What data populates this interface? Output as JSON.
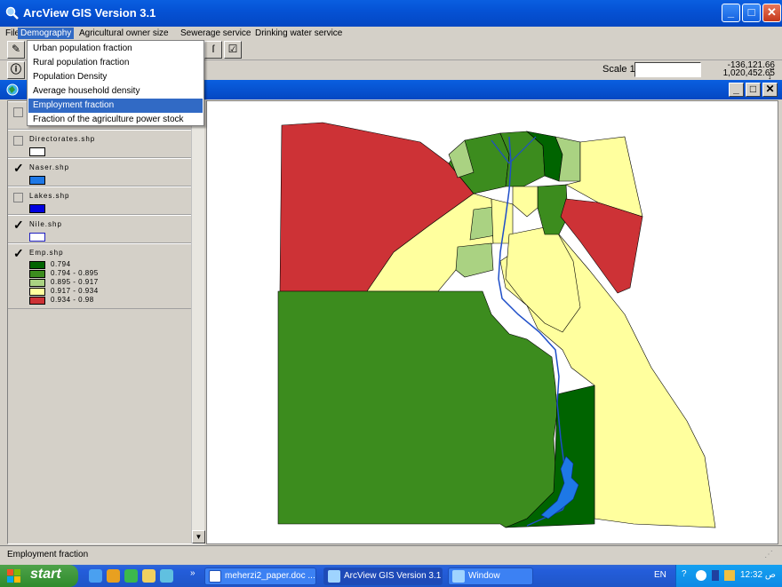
{
  "window": {
    "title": "ArcView GIS Version 3.1"
  },
  "menubar": {
    "items": [
      {
        "label": "File",
        "active": false
      },
      {
        "label": "Demography",
        "active": true
      },
      {
        "label": "Agricultural owner size",
        "active": false
      },
      {
        "label": "Sewerage service",
        "active": false
      },
      {
        "label": "Drinking water service",
        "active": false
      }
    ]
  },
  "dropdown": {
    "items": [
      {
        "label": "Urban population fraction",
        "selected": false
      },
      {
        "label": "Rural population fraction",
        "selected": false
      },
      {
        "label": "Population Density",
        "selected": false
      },
      {
        "label": "Average household density",
        "selected": false
      },
      {
        "label": "Employment fraction",
        "selected": true
      },
      {
        "label": "Fraction of the agriculture power stock",
        "selected": false
      }
    ]
  },
  "toolbar": {
    "scale_label": "Scale 1:",
    "scale_value": "",
    "coord_x": "-136,121.66",
    "coord_y": "1,020,452.65"
  },
  "toc": {
    "themes": [
      {
        "name": "Directorates.shp",
        "visible": false,
        "swatch": "#ffffff"
      },
      {
        "name": "Naser.shp",
        "visible": true,
        "swatch": "#1e78e6"
      },
      {
        "name": "Lakes.shp",
        "visible": false,
        "swatch": "#0000e0"
      },
      {
        "name": "Nile.shp",
        "visible": true,
        "swatch": "#ffffff"
      },
      {
        "name": "Emp.shp",
        "visible": true
      }
    ],
    "legend": [
      {
        "label": "0.794",
        "color": "#006400"
      },
      {
        "label": "0.794 - 0.895",
        "color": "#3c8c1e"
      },
      {
        "label": "0.895 - 0.917",
        "color": "#aad282"
      },
      {
        "label": "0.917 - 0.934",
        "color": "#ffff9e"
      },
      {
        "label": "0.934 - 0.98",
        "color": "#cd3236"
      }
    ]
  },
  "status": {
    "text": "Employment fraction"
  },
  "taskbar": {
    "start_label": "start",
    "tasks": [
      {
        "label": "meherzi2_paper.doc ...",
        "active": false
      },
      {
        "label": "ArcView GIS Version 3.1",
        "active": true
      },
      {
        "label": "Window",
        "active": false
      }
    ],
    "lang": "EN",
    "clock": "12:32 ص"
  },
  "colors": {
    "accent": "#316ac5",
    "titlebar": "#0552d5",
    "class1": "#006400",
    "class2": "#3c8c1e",
    "class3": "#aad282",
    "class4": "#ffff9e",
    "class5": "#cd3236",
    "water": "#1e78e6"
  }
}
